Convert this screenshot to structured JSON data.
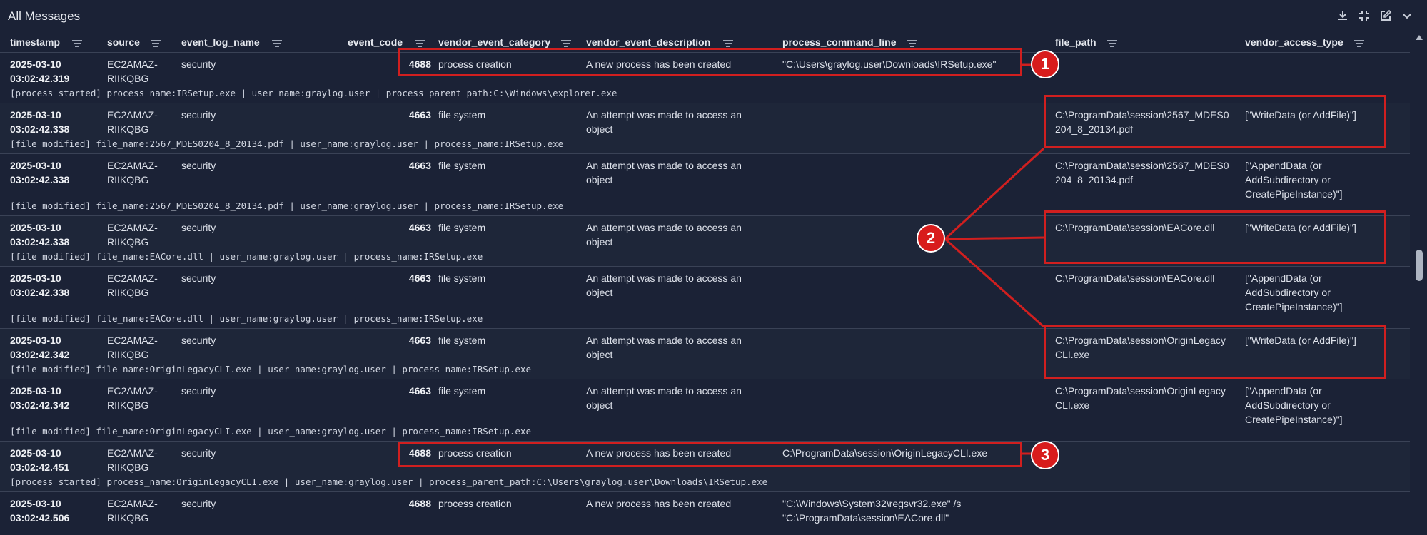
{
  "panel": {
    "title": "All Messages",
    "tools": [
      "download-icon",
      "collapse-icon",
      "edit-icon",
      "chevron-down-icon"
    ]
  },
  "columns": [
    "timestamp",
    "source",
    "event_log_name",
    "event_code",
    "vendor_event_category",
    "vendor_event_description",
    "process_command_line",
    "file_path",
    "vendor_access_type"
  ],
  "rows": [
    {
      "date": "2025-03-10",
      "time": "03:02:42.319",
      "source_1": "EC2AMAZ-",
      "source_2": "RIIKQBG",
      "log": "security",
      "code": "4688",
      "category": "process creation",
      "desc": "A new process has been created",
      "desc_2": "",
      "cmd": "\"C:\\Users\\graylog.user\\Downloads\\IRSetup.exe\"",
      "cmd_2": "",
      "path": "",
      "path_2": "",
      "access": "",
      "access_2": "",
      "access_3": "",
      "summary": "[process started] process_name:IRSetup.exe | user_name:graylog.user | process_parent_path:C:\\Windows\\explorer.exe"
    },
    {
      "date": "2025-03-10",
      "time": "03:02:42.338",
      "source_1": "EC2AMAZ-",
      "source_2": "RIIKQBG",
      "log": "security",
      "code": "4663",
      "category": "file system",
      "desc": "An attempt was made to access an",
      "desc_2": "object",
      "cmd": "",
      "cmd_2": "",
      "path": "C:\\ProgramData\\session\\2567_MDES0",
      "path_2": "204_8_20134.pdf",
      "access": "[\"WriteData (or AddFile)\"]",
      "access_2": "",
      "access_3": "",
      "summary": "[file modified] file_name:2567_MDES0204_8_20134.pdf | user_name:graylog.user | process_name:IRSetup.exe"
    },
    {
      "date": "2025-03-10",
      "time": "03:02:42.338",
      "source_1": "EC2AMAZ-",
      "source_2": "RIIKQBG",
      "log": "security",
      "code": "4663",
      "category": "file system",
      "desc": "An attempt was made to access an",
      "desc_2": "object",
      "cmd": "",
      "cmd_2": "",
      "path": "C:\\ProgramData\\session\\2567_MDES0",
      "path_2": "204_8_20134.pdf",
      "access": "[\"AppendData (or",
      "access_2": "AddSubdirectory or",
      "access_3": "CreatePipeInstance)\"]",
      "summary": "[file modified] file_name:2567_MDES0204_8_20134.pdf | user_name:graylog.user | process_name:IRSetup.exe"
    },
    {
      "date": "2025-03-10",
      "time": "03:02:42.338",
      "source_1": "EC2AMAZ-",
      "source_2": "RIIKQBG",
      "log": "security",
      "code": "4663",
      "category": "file system",
      "desc": "An attempt was made to access an",
      "desc_2": "object",
      "cmd": "",
      "cmd_2": "",
      "path": "C:\\ProgramData\\session\\EACore.dll",
      "path_2": "",
      "access": "[\"WriteData (or AddFile)\"]",
      "access_2": "",
      "access_3": "",
      "summary": "[file modified] file_name:EACore.dll | user_name:graylog.user | process_name:IRSetup.exe"
    },
    {
      "date": "2025-03-10",
      "time": "03:02:42.338",
      "source_1": "EC2AMAZ-",
      "source_2": "RIIKQBG",
      "log": "security",
      "code": "4663",
      "category": "file system",
      "desc": "An attempt was made to access an",
      "desc_2": "object",
      "cmd": "",
      "cmd_2": "",
      "path": "C:\\ProgramData\\session\\EACore.dll",
      "path_2": "",
      "access": "[\"AppendData (or",
      "access_2": "AddSubdirectory or",
      "access_3": "CreatePipeInstance)\"]",
      "summary": "[file modified] file_name:EACore.dll | user_name:graylog.user | process_name:IRSetup.exe"
    },
    {
      "date": "2025-03-10",
      "time": "03:02:42.342",
      "source_1": "EC2AMAZ-",
      "source_2": "RIIKQBG",
      "log": "security",
      "code": "4663",
      "category": "file system",
      "desc": "An attempt was made to access an",
      "desc_2": "object",
      "cmd": "",
      "cmd_2": "",
      "path": "C:\\ProgramData\\session\\OriginLegacy",
      "path_2": "CLI.exe",
      "access": "[\"WriteData (or AddFile)\"]",
      "access_2": "",
      "access_3": "",
      "summary": "[file modified] file_name:OriginLegacyCLI.exe | user_name:graylog.user | process_name:IRSetup.exe"
    },
    {
      "date": "2025-03-10",
      "time": "03:02:42.342",
      "source_1": "EC2AMAZ-",
      "source_2": "RIIKQBG",
      "log": "security",
      "code": "4663",
      "category": "file system",
      "desc": "An attempt was made to access an",
      "desc_2": "object",
      "cmd": "",
      "cmd_2": "",
      "path": "C:\\ProgramData\\session\\OriginLegacy",
      "path_2": "CLI.exe",
      "access": "[\"AppendData (or",
      "access_2": "AddSubdirectory or",
      "access_3": "CreatePipeInstance)\"]",
      "summary": "[file modified] file_name:OriginLegacyCLI.exe | user_name:graylog.user | process_name:IRSetup.exe"
    },
    {
      "date": "2025-03-10",
      "time": "03:02:42.451",
      "source_1": "EC2AMAZ-",
      "source_2": "RIIKQBG",
      "log": "security",
      "code": "4688",
      "category": "process creation",
      "desc": "A new process has been created",
      "desc_2": "",
      "cmd": "C:\\ProgramData\\session\\OriginLegacyCLI.exe",
      "cmd_2": "",
      "path": "",
      "path_2": "",
      "access": "",
      "access_2": "",
      "access_3": "",
      "summary": "[process started] process_name:OriginLegacyCLI.exe | user_name:graylog.user | process_parent_path:C:\\Users\\graylog.user\\Downloads\\IRSetup.exe"
    },
    {
      "date": "2025-03-10",
      "time": "03:02:42.506",
      "source_1": "EC2AMAZ-",
      "source_2": "RIIKQBG",
      "log": "security",
      "code": "4688",
      "category": "process creation",
      "desc": "A new process has been created",
      "desc_2": "",
      "cmd": "\"C:\\Windows\\System32\\regsvr32.exe\" /s",
      "cmd_2": "\"C:\\ProgramData\\session\\EACore.dll\"",
      "path": "",
      "path_2": "",
      "access": "",
      "access_2": "",
      "access_3": "",
      "summary": ""
    }
  ],
  "annotations": {
    "badges": [
      "1",
      "2",
      "3"
    ],
    "color": "#d11f1f"
  },
  "colors": {
    "background": "#1b2236",
    "accent": "#d11f1f"
  }
}
